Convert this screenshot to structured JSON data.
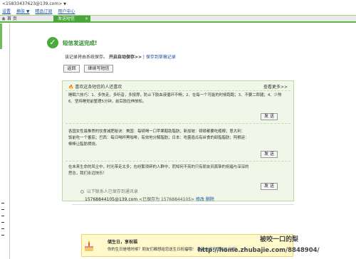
{
  "account": {
    "phone": "<15833437623@139.com>",
    "caret": "▼"
  },
  "top_links": [
    "设置",
    "换肤 ▼",
    "精品订阅",
    "用户中心"
  ],
  "tabs": {
    "home": "首 页",
    "compose": "发送短信",
    "close": "×"
  },
  "success": {
    "title": "短信发送完成!",
    "note_prefix": "该记录将由系统保存。",
    "note_auto": "开启自动保存>>",
    "note_link": "| 保存到草稿记录"
  },
  "buttons": {
    "back": "返回",
    "continue": "继续写短信"
  },
  "tips_panel": {
    "header_icon": "🔥",
    "header": "喜欢这条短信的人还喜欢",
    "more": "查看更多>>",
    "send_label": "发 送",
    "items": [
      {
        "lines": [
          "睡眠六技巧：1、多快走，多听音，多按摩，防止下肢血液循环不畅；2、在每一个可能的时候跑跑；3、不要二郎腿；4、少熬夜；5、多吃香蕉、芹菜、紫菜等含钾食物，排除多余水分，避免脂肪堆积以及水肿；",
          "6、坚持睡觉前整理5分钟，前后肢拉伸放松。"
        ]
      },
      {
        "lines": [
          "各国女性最推崇的饮食减肥秘诀：美国：每顿喝一口苹果醋助脂肪；新加坡：顿顿都要吃粗粮；意大利：",
          "饭前吃一个番茄；巴西：每日喝杯黑咖啡，有效地分解脂肪；日本：吃菌造瓜有丝食的卸脂脂肪；阿根廷：",
          "棒棒让脂肪燃烧。"
        ]
      },
      {
        "lines": [
          "在未来生命的风尘中，时光带走太多；在纷繁琐碎的人群中，而知何不亮的只有朋友间真挚的祝福与深深的",
          "思念，我们永远快乐！"
        ]
      }
    ]
  },
  "recipients": {
    "header": "以下联系人已保存到通讯录",
    "entry": "15768844105@139.com",
    "entry_sub": "<已保存为 15768844105>",
    "edit": "修改",
    "delete": "删除"
  },
  "birthday": {
    "title": "储生日，享祝福",
    "text": "你的生日是啥时候？朋友们都想给您送生日祝福哦！",
    "link": "赶紧去填写您的生日吧！",
    "arrow": ">>"
  },
  "watermark": {
    "line1": "被咬一口的梨",
    "line2": "http://home.zhubajie.com/8848904/"
  }
}
